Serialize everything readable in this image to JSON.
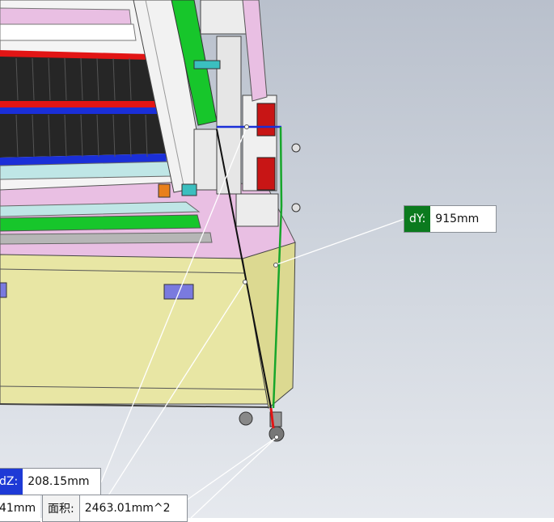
{
  "measurements": {
    "dy": {
      "label": "dY:",
      "value": "915mm",
      "color": "#0b7a1e"
    },
    "dz": {
      "label": "dZ:",
      "value": "208.15mm",
      "color": "#1e3ad6"
    },
    "partial": {
      "value": "41mm"
    },
    "area": {
      "label": "面积:",
      "value": "2463.01mm^2"
    }
  },
  "colors": {
    "frame_yellow": "#e8e6a4",
    "panel_pink": "#e9bfe3",
    "rail_green": "#17c62b",
    "rail_blue": "#1a2fd8",
    "rail_red": "#e21515",
    "rail_cyan": "#bfe6e6"
  }
}
